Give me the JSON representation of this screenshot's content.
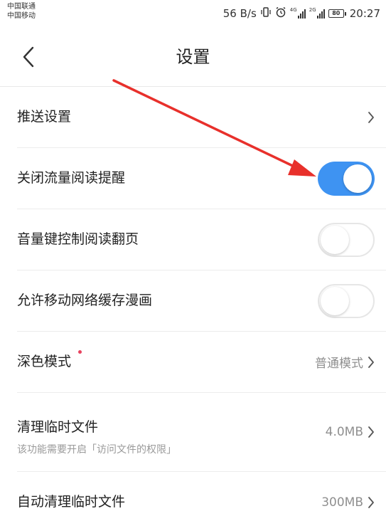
{
  "status_bar": {
    "carrier_1": "中国联通",
    "carrier_2": "中国移动",
    "net_speed": "56 B/s",
    "signal_1_tag": "4G",
    "signal_2_tag": "2G",
    "battery": "80",
    "time": "20:27"
  },
  "header": {
    "title": "设置",
    "back_icon": "chevron-left-icon"
  },
  "settings": {
    "push": {
      "label": "推送设置"
    },
    "data_reminder": {
      "label": "关闭流量阅读提醒",
      "enabled": true
    },
    "volume_page_turn": {
      "label": "音量键控制阅读翻页",
      "enabled": false
    },
    "mobile_cache": {
      "label": "允许移动网络缓存漫画",
      "enabled": false
    },
    "dark_mode": {
      "label": "深色模式",
      "value": "普通模式",
      "badge": true
    },
    "clear_temp": {
      "label": "清理临时文件",
      "sublabel": "该功能需要开启「访问文件的权限」",
      "value": "4.0MB"
    },
    "auto_clear": {
      "label": "自动清理临时文件",
      "value": "300MB"
    }
  },
  "colors": {
    "toggle_on": "#3e93f2",
    "toggle_off_border": "#e6e6e6",
    "badge": "#e8435f",
    "annotation_arrow": "#e8302b"
  }
}
